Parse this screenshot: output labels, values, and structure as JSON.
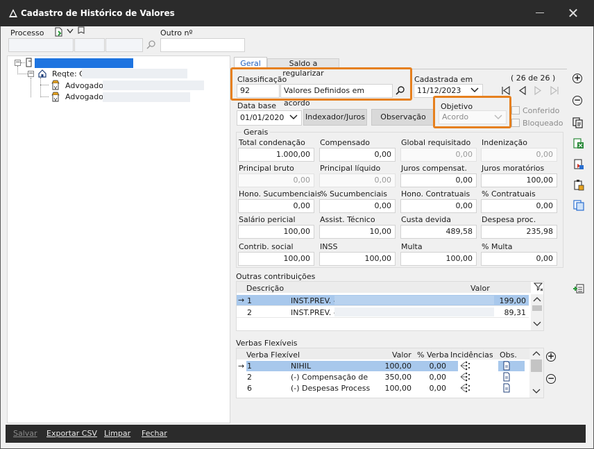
{
  "window": {
    "title": "Cadastro de Histórico de Valores",
    "minimize_glyph": "—",
    "close_glyph": "✕"
  },
  "header": {
    "processo_label": "Processo",
    "outro_label": "Outro nº"
  },
  "tree": {
    "reqte_label": "Reqte: C",
    "advogado_1": "Advogado",
    "advogado_2": "Advogado"
  },
  "tabs": [
    {
      "label": "Geral",
      "active": true
    },
    {
      "label": "Saldo a regularizar",
      "active": false
    }
  ],
  "classificacao": {
    "label": "Classificação",
    "code": "92",
    "description": "Valores Definidos em acordo"
  },
  "cadastrada": {
    "label": "Cadastrada em",
    "date": "11/12/2023",
    "counter": "( 26 de 26 )"
  },
  "data_base": {
    "label": "Data base",
    "date": "01/01/2020"
  },
  "buttons": {
    "indexador": "Indexador/Juros",
    "observacao": "Observação"
  },
  "objetivo": {
    "label": "Objetivo",
    "value": "Acordo"
  },
  "checkboxes": {
    "conferido": "Conferido",
    "bloqueado": "Bloqueado"
  },
  "gerais": {
    "legend": "Gerais",
    "fields": [
      {
        "label": "Total condenação",
        "value": "1.000,00",
        "disabled": false
      },
      {
        "label": "Compensado",
        "value": "0,00",
        "disabled": false
      },
      {
        "label": "Global requisitado",
        "value": "0,00",
        "disabled": true
      },
      {
        "label": "Indenização",
        "value": "0,00",
        "disabled": true
      },
      {
        "label": "Principal bruto",
        "value": "0,00",
        "disabled": true
      },
      {
        "label": "Principal líquido",
        "value": "0,00",
        "disabled": true
      },
      {
        "label": "Juros compensat.",
        "value": "0,00",
        "disabled": false
      },
      {
        "label": "Juros moratórios",
        "value": "100,00",
        "disabled": false
      },
      {
        "label": "Hono. Sucumbenciais",
        "value": "0,00",
        "disabled": false
      },
      {
        "label": "% Sucumbenciais",
        "value": "0,00",
        "disabled": false
      },
      {
        "label": "Hono. Contratuais",
        "value": "0,00",
        "disabled": false
      },
      {
        "label": "% Contratuais",
        "value": "0,00",
        "disabled": false
      },
      {
        "label": "Salário pericial",
        "value": "100,00",
        "disabled": false
      },
      {
        "label": "Assist. Técnico",
        "value": "10,00",
        "disabled": false
      },
      {
        "label": "Custa devida",
        "value": "489,58",
        "disabled": false
      },
      {
        "label": "Despesa proc.",
        "value": "235,98",
        "disabled": false
      },
      {
        "label": "Contrib. social",
        "value": "100,00",
        "disabled": false
      },
      {
        "label": "INSS",
        "value": "100,00",
        "disabled": false
      },
      {
        "label": "Multa",
        "value": "100,00",
        "disabled": false
      },
      {
        "label": "% Multa",
        "value": "0,00",
        "disabled": false
      }
    ]
  },
  "outras": {
    "legend": "Outras contribuições",
    "columns": [
      "Descrição",
      "Valor"
    ],
    "rows": [
      {
        "idx": "1",
        "desc": "INST.PREV. -",
        "valor": "199,00",
        "selected": true
      },
      {
        "idx": "2",
        "desc": "INST.PREV. -",
        "valor": "89,31",
        "selected": false
      }
    ]
  },
  "verbas": {
    "legend": "Verbas Flexíveis",
    "columns": [
      "Verba Flexível",
      "Valor",
      "% Verba",
      "Incidências",
      "Obs."
    ],
    "rows": [
      {
        "idx": "1",
        "verba": "NIHIL",
        "valor": "100,00",
        "pct": "0,00",
        "selected": true
      },
      {
        "idx": "2",
        "verba": "(-) Compensação de",
        "valor": "350,00",
        "pct": "0,00",
        "selected": false
      },
      {
        "idx": "6",
        "verba": "(-) Despesas Process",
        "valor": "100,00",
        "pct": "0,00",
        "selected": false
      }
    ]
  },
  "bottom": {
    "salvar": "Salvar",
    "exportar": "Exportar CSV",
    "limpar": "Limpar",
    "fechar": "Fechar"
  },
  "colors": {
    "accent_orange": "#e6801e",
    "selected_row": "#a8c8ec",
    "titlebar": "#2b2b2b"
  }
}
